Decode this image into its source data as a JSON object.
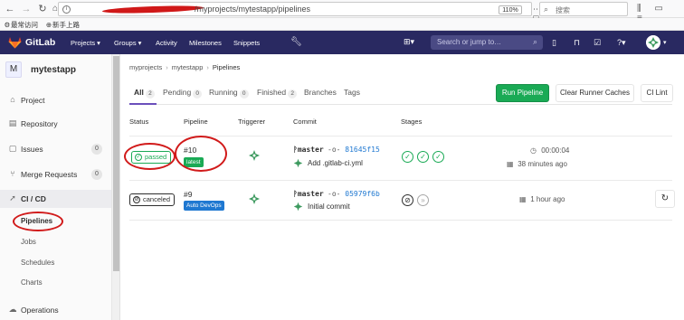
{
  "browser": {
    "url": "/myprojects/mytestapp/pipelines",
    "zoom": "110%",
    "search_placeholder": "搜索",
    "bookmarks": [
      "最常访问",
      "新手上路"
    ]
  },
  "gitlab_nav": {
    "brand": "GitLab",
    "menu": [
      "Projects ▾",
      "Groups ▾",
      "Activity",
      "Milestones",
      "Snippets"
    ],
    "search_placeholder": "Search or jump to…"
  },
  "sidebar": {
    "project_initial": "M",
    "project_name": "mytestapp",
    "items": [
      {
        "label": "Project",
        "icon": "home-icon"
      },
      {
        "label": "Repository",
        "icon": "repository-icon"
      },
      {
        "label": "Issues",
        "count": "0",
        "icon": "issues-icon"
      },
      {
        "label": "Merge Requests",
        "count": "0",
        "icon": "merge-request-icon"
      },
      {
        "label": "CI / CD",
        "icon": "rocket-icon"
      },
      {
        "label": "Operations",
        "icon": "cloud-icon"
      }
    ],
    "ci_sub": [
      "Pipelines",
      "Jobs",
      "Schedules",
      "Charts"
    ]
  },
  "breadcrumb": [
    "myprojects",
    "mytestapp",
    "Pipelines"
  ],
  "tabs": [
    {
      "label": "All",
      "count": "2"
    },
    {
      "label": "Pending",
      "count": "0"
    },
    {
      "label": "Running",
      "count": "0"
    },
    {
      "label": "Finished",
      "count": "2"
    },
    {
      "label": "Branches"
    },
    {
      "label": "Tags"
    }
  ],
  "buttons": {
    "run_pipeline": "Run Pipeline",
    "clear_cache": "Clear Runner Caches",
    "ci_lint": "CI Lint"
  },
  "table_headers": [
    "Status",
    "Pipeline",
    "Triggerer",
    "Commit",
    "Stages"
  ],
  "pipelines": [
    {
      "status": "passed",
      "id": "#10",
      "badge": "latest",
      "ref": "master",
      "sha": "81645f15",
      "message": "Add .gitlab-ci.yml",
      "duration": "00:00:04",
      "finished": "38 minutes ago"
    },
    {
      "status": "canceled",
      "id": "#9",
      "badge": "Auto DevOps",
      "ref": "master",
      "sha": "05979f6b",
      "message": "Initial commit",
      "finished": "1 hour ago"
    }
  ],
  "colors": {
    "nav_bg": "#292961",
    "success": "#1aaa55",
    "link": "#1f78d1",
    "annotation_red": "#d11a1a"
  }
}
